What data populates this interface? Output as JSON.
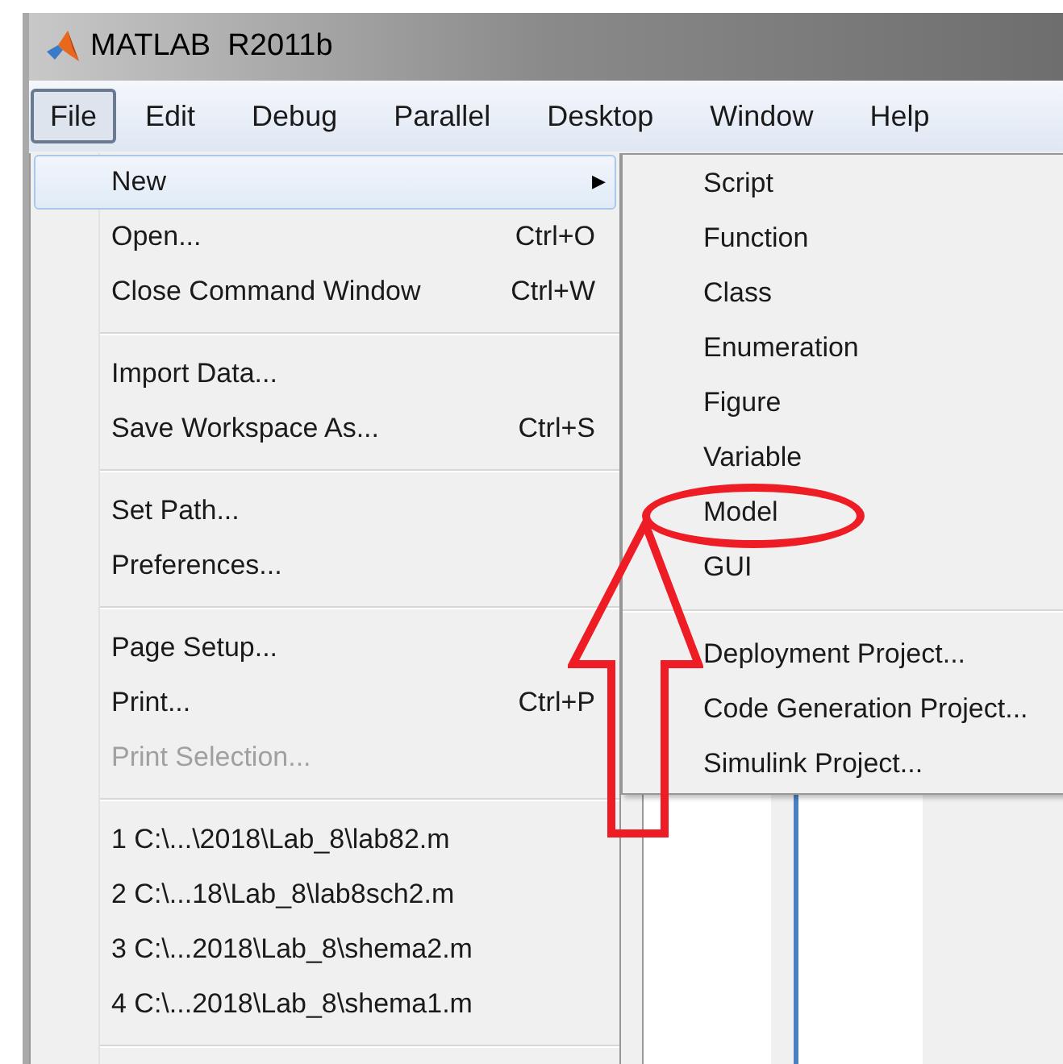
{
  "window": {
    "title": "MATLAB  R2011b"
  },
  "menubar": [
    {
      "label": "File",
      "selected": true
    },
    {
      "label": "Edit",
      "selected": false
    },
    {
      "label": "Debug",
      "selected": false
    },
    {
      "label": "Parallel",
      "selected": false
    },
    {
      "label": "Desktop",
      "selected": false
    },
    {
      "label": "Window",
      "selected": false
    },
    {
      "label": "Help",
      "selected": false
    }
  ],
  "file_menu": [
    {
      "kind": "item",
      "label": "New",
      "selected": true,
      "disabled": false,
      "submenu_arrow": "▶"
    },
    {
      "kind": "item",
      "label": "Open...",
      "shortcut": "Ctrl+O",
      "selected": false,
      "disabled": false
    },
    {
      "kind": "item",
      "label": "Close Command Window",
      "shortcut": "Ctrl+W",
      "selected": false,
      "disabled": false
    },
    {
      "kind": "separator"
    },
    {
      "kind": "item",
      "label": "Import Data...",
      "selected": false,
      "disabled": false
    },
    {
      "kind": "item",
      "label": "Save Workspace As...",
      "shortcut": "Ctrl+S",
      "selected": false,
      "disabled": false
    },
    {
      "kind": "separator"
    },
    {
      "kind": "item",
      "label": "Set Path...",
      "selected": false,
      "disabled": false
    },
    {
      "kind": "item",
      "label": "Preferences...",
      "selected": false,
      "disabled": false
    },
    {
      "kind": "separator"
    },
    {
      "kind": "item",
      "label": "Page Setup...",
      "selected": false,
      "disabled": false
    },
    {
      "kind": "item",
      "label": "Print...",
      "shortcut": "Ctrl+P",
      "selected": false,
      "disabled": false
    },
    {
      "kind": "item",
      "label": "Print Selection...",
      "selected": false,
      "disabled": true
    },
    {
      "kind": "separator"
    },
    {
      "kind": "item",
      "label": "1 C:\\...\\2018\\Lab_8\\lab82.m",
      "selected": false,
      "disabled": false
    },
    {
      "kind": "item",
      "label": "2 C:\\...18\\Lab_8\\lab8sch2.m",
      "selected": false,
      "disabled": false
    },
    {
      "kind": "item",
      "label": "3 C:\\...2018\\Lab_8\\shema2.m",
      "selected": false,
      "disabled": false
    },
    {
      "kind": "item",
      "label": "4 C:\\...2018\\Lab_8\\shema1.m",
      "selected": false,
      "disabled": false
    },
    {
      "kind": "separator"
    }
  ],
  "new_submenu": [
    {
      "kind": "item",
      "label": "Script",
      "circled": false
    },
    {
      "kind": "item",
      "label": "Function",
      "circled": false
    },
    {
      "kind": "item",
      "label": "Class",
      "circled": false
    },
    {
      "kind": "item",
      "label": "Enumeration",
      "circled": false
    },
    {
      "kind": "item",
      "label": "Figure",
      "circled": false
    },
    {
      "kind": "item",
      "label": "Variable",
      "circled": false
    },
    {
      "kind": "item",
      "label": "Model",
      "circled": true
    },
    {
      "kind": "item",
      "label": "GUI",
      "circled": false
    },
    {
      "kind": "separator"
    },
    {
      "kind": "item",
      "label": "Deployment Project...",
      "circled": false
    },
    {
      "kind": "item",
      "label": "Code Generation Project...",
      "circled": false
    },
    {
      "kind": "item",
      "label": "Simulink Project...",
      "circled": false
    }
  ]
}
